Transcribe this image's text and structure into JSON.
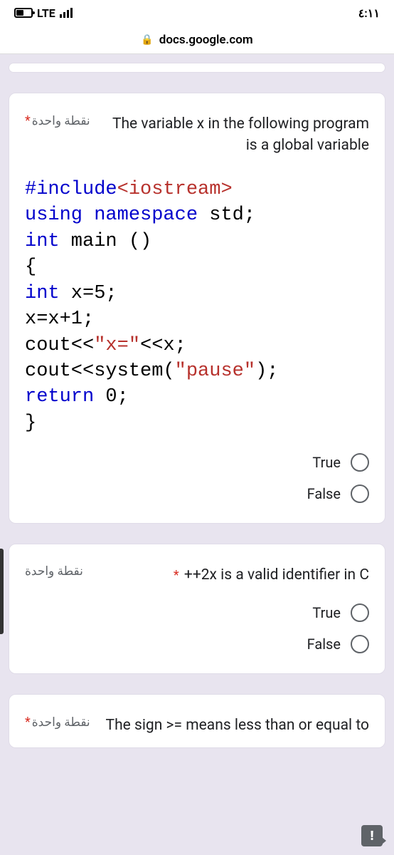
{
  "status_bar": {
    "carrier": "LTE",
    "time": "٤:١١"
  },
  "url_bar": {
    "domain": "docs.google.com"
  },
  "questions": {
    "q1": {
      "points": "نقطة واحدة",
      "text": "The variable x in the following program is a global variable",
      "code": {
        "l1a": "#include",
        "l1b": "<iostream>",
        "l2a": "using",
        "l2b": " namespace ",
        "l2c": "std;",
        "l3a": "int",
        "l3b": " main ()",
        "l4": "{",
        "l5a": "int",
        "l5b": " x=5;",
        "l6": "x=x+1;",
        "l7a": "cout<<",
        "l7b": "\"x=\"",
        "l7c": "<<x;",
        "l8a": "cout<<system(",
        "l8b": "\"pause\"",
        "l8c": ");",
        "l9a": "return",
        "l9b": " 0;",
        "l10": "}"
      },
      "opt_true": "True",
      "opt_false": "False"
    },
    "q2": {
      "points": "نقطة واحدة",
      "text": "++2x is a valid identifier in C",
      "opt_true": "True",
      "opt_false": "False"
    },
    "q3": {
      "points": "نقطة واحدة",
      "text": "The sign >= means less than or equal to"
    }
  },
  "warning": "!"
}
